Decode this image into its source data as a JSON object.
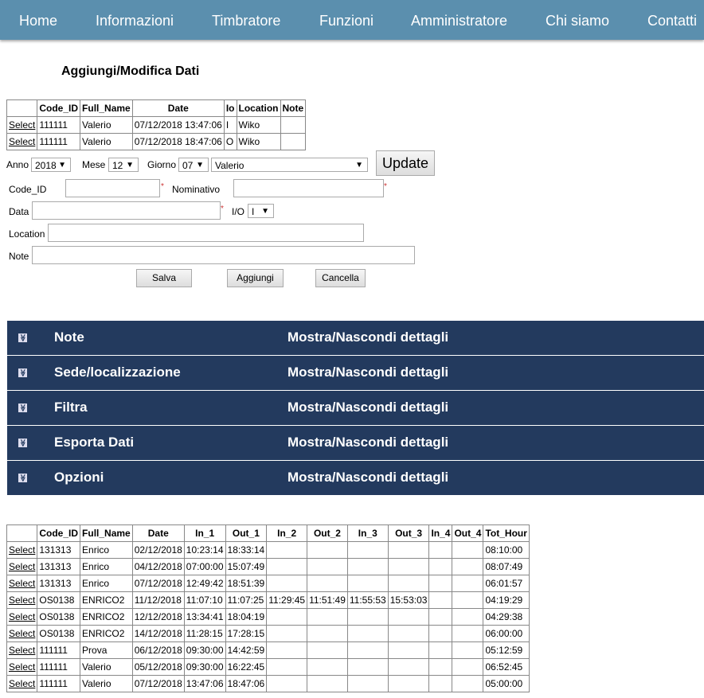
{
  "nav": [
    "Home",
    "Informazioni",
    "Timbratore",
    "Funzioni",
    "Amministratore",
    "Chi siamo",
    "Contatti"
  ],
  "title": "Aggiungi/Modifica Dati",
  "table1": {
    "headers": [
      "",
      "Code_ID",
      "Full_Name",
      "Date",
      "Io",
      "Location",
      "Note"
    ],
    "rows": [
      [
        "Select",
        "111111",
        "Valerio",
        "07/12/2018 13:47:06",
        "I",
        "Wiko",
        ""
      ],
      [
        "Select",
        "111111",
        "Valerio",
        "07/12/2018 18:47:06",
        "O",
        "Wiko",
        ""
      ]
    ]
  },
  "form": {
    "anno_label": "Anno",
    "anno": "2018",
    "mese_label": "Mese",
    "mese": "12",
    "giorno_label": "Giorno",
    "giorno": "07",
    "persona": "Valerio",
    "update": "Update",
    "code_label": "Code_ID",
    "nominativo_label": "Nominativo",
    "data_label": "Data",
    "io_label": "I/O",
    "io": "I",
    "location_label": "Location",
    "note_label": "Note",
    "required": "*",
    "salva": "Salva",
    "aggiungi": "Aggiungi",
    "cancella": "Cancella"
  },
  "accordion": {
    "toggle_text": "Mostra/Nascondi dettagli",
    "items": [
      "Note",
      "Sede/localizzazione",
      "Filtra",
      "Esporta Dati",
      "Opzioni"
    ]
  },
  "table2": {
    "headers": [
      "",
      "Code_ID",
      "Full_Name",
      "Date",
      "In_1",
      "Out_1",
      "In_2",
      "Out_2",
      "In_3",
      "Out_3",
      "In_4",
      "Out_4",
      "Tot_Hour"
    ],
    "rows": [
      [
        "Select",
        "131313",
        "Enrico",
        "02/12/2018",
        "10:23:14",
        "18:33:14",
        "",
        "",
        "",
        "",
        "",
        "",
        "08:10:00"
      ],
      [
        "Select",
        "131313",
        "Enrico",
        "04/12/2018",
        "07:00:00",
        "15:07:49",
        "",
        "",
        "",
        "",
        "",
        "",
        "08:07:49"
      ],
      [
        "Select",
        "131313",
        "Enrico",
        "07/12/2018",
        "12:49:42",
        "18:51:39",
        "",
        "",
        "",
        "",
        "",
        "",
        "06:01:57"
      ],
      [
        "Select",
        "OS0138",
        "ENRICO2",
        "11/12/2018",
        "11:07:10",
        "11:07:25",
        "11:29:45",
        "11:51:49",
        "11:55:53",
        "15:53:03",
        "",
        "",
        "04:19:29"
      ],
      [
        "Select",
        "OS0138",
        "ENRICO2",
        "12/12/2018",
        "13:34:41",
        "18:04:19",
        "",
        "",
        "",
        "",
        "",
        "",
        "04:29:38"
      ],
      [
        "Select",
        "OS0138",
        "ENRICO2",
        "14/12/2018",
        "11:28:15",
        "17:28:15",
        "",
        "",
        "",
        "",
        "",
        "",
        "06:00:00"
      ],
      [
        "Select",
        "111111",
        "Prova",
        "06/12/2018",
        "09:30:00",
        "14:42:59",
        "",
        "",
        "",
        "",
        "",
        "",
        "05:12:59"
      ],
      [
        "Select",
        "111111",
        "Valerio",
        "05/12/2018",
        "09:30:00",
        "16:22:45",
        "",
        "",
        "",
        "",
        "",
        "",
        "06:52:45"
      ],
      [
        "Select",
        "111111",
        "Valerio",
        "07/12/2018",
        "13:47:06",
        "18:47:06",
        "",
        "",
        "",
        "",
        "",
        "",
        "05:00:00"
      ]
    ]
  }
}
